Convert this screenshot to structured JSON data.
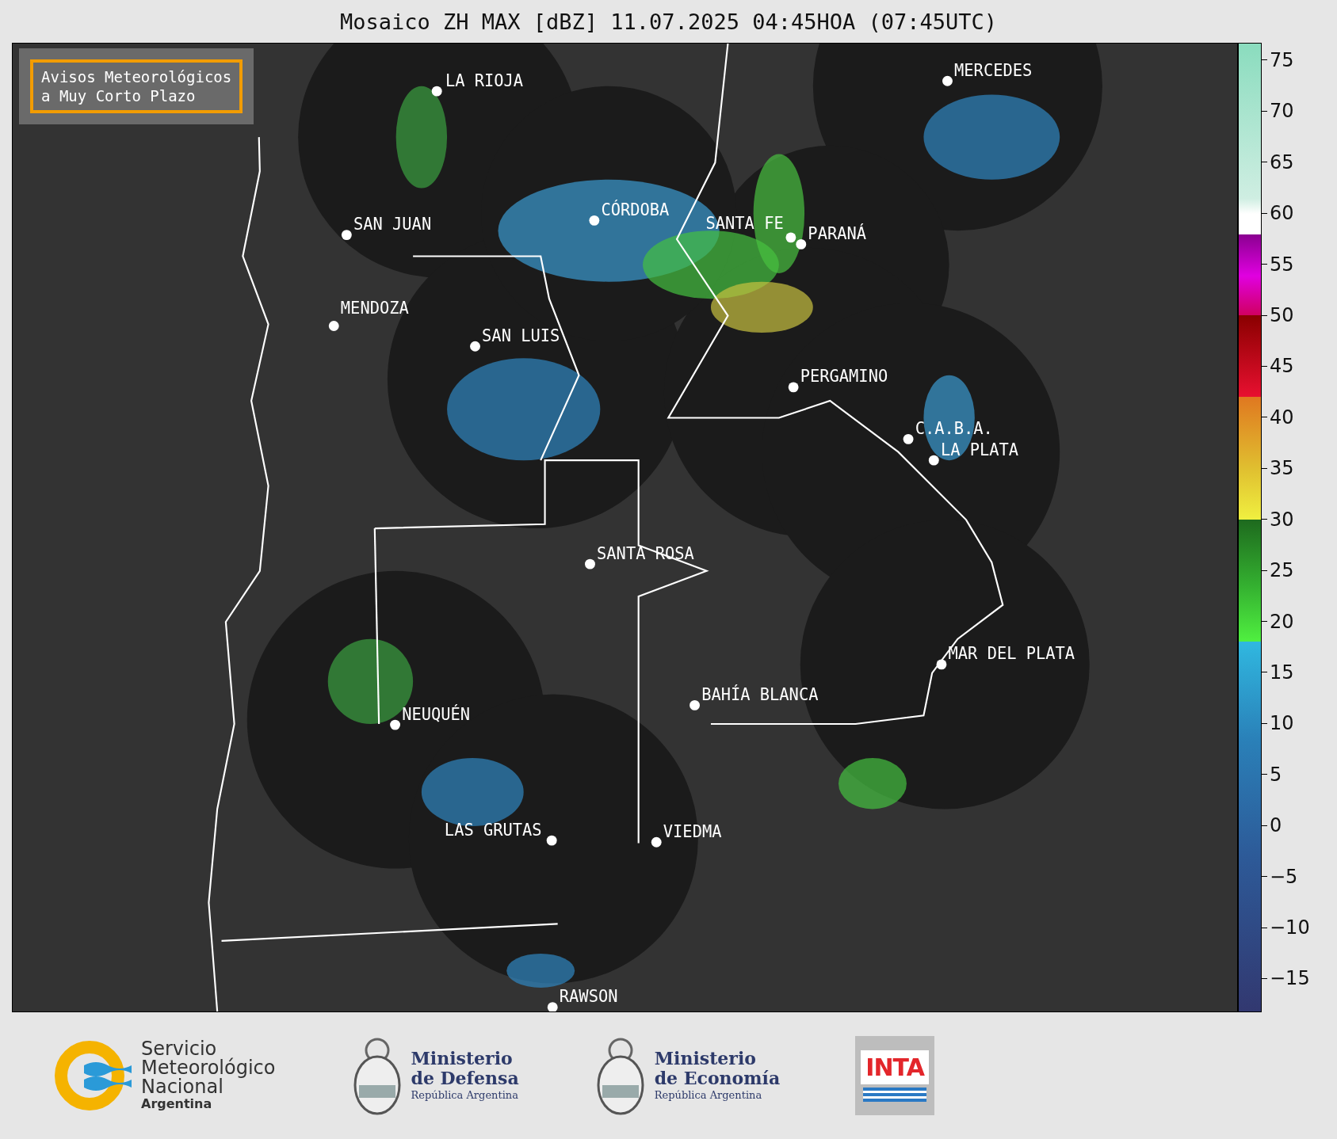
{
  "title": "Mosaico ZH MAX [dBZ] 11.07.2025 04:45HOA (07:45UTC)",
  "alert_box": {
    "lines": [
      "Avisos Meteorológicos",
      "a Muy Corto Plazo"
    ]
  },
  "cities": [
    {
      "name": "LA RIOJA"
    },
    {
      "name": "SAN JUAN"
    },
    {
      "name": "CÓRDOBA"
    },
    {
      "name": "SANTA FE"
    },
    {
      "name": "PARANÁ"
    },
    {
      "name": "MERCEDES"
    },
    {
      "name": "MENDOZA"
    },
    {
      "name": "SAN LUIS"
    },
    {
      "name": "PERGAMINO"
    },
    {
      "name": "C.A.B.A."
    },
    {
      "name": "LA PLATA"
    },
    {
      "name": "SANTA ROSA"
    },
    {
      "name": "MAR DEL PLATA"
    },
    {
      "name": "BAHÍA BLANCA"
    },
    {
      "name": "NEUQUÉN"
    },
    {
      "name": "LAS GRUTAS"
    },
    {
      "name": "VIEDMA"
    },
    {
      "name": "RAWSON"
    }
  ],
  "colorbar": {
    "ticks": [
      "75",
      "70",
      "65",
      "60",
      "55",
      "50",
      "45",
      "40",
      "35",
      "30",
      "25",
      "20",
      "15",
      "10",
      "5",
      "0",
      "−5",
      "−10",
      "−15"
    ]
  },
  "footer": {
    "logos": [
      {
        "kind": "smn",
        "lines": [
          "Servicio",
          "Meteorológico",
          "Nacional",
          "Argentina"
        ]
      },
      {
        "kind": "ministry",
        "lines": [
          "Ministerio",
          "de Defensa",
          "República Argentina"
        ]
      },
      {
        "kind": "ministry",
        "lines": [
          "Ministerio",
          "de Economía",
          "República Argentina"
        ]
      },
      {
        "kind": "inta",
        "lines": [
          "INTA"
        ]
      }
    ]
  }
}
